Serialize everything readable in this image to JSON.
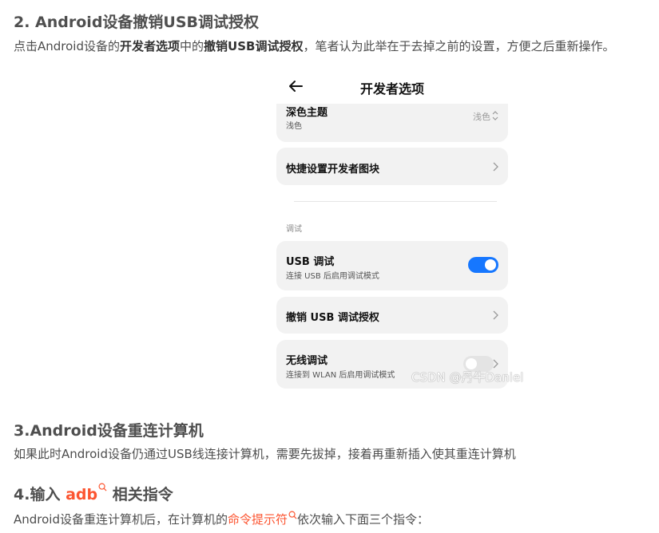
{
  "section2": {
    "heading": "2. Android设备撤销USB调试授权",
    "text_1": "点击Android设备的",
    "bold_1": "开发者选项",
    "text_2": "中的",
    "bold_2": "撤销USB调试授权",
    "text_3": "，笔者认为此举在于去掉之前的设置，方便之后重新操作。"
  },
  "phone": {
    "title": "开发者选项",
    "dark_theme": {
      "label": "深色主题",
      "sub": "浅色",
      "value": "浅色"
    },
    "quick_tiles": {
      "label": "快捷设置开发者图块"
    },
    "debug_section": "调试",
    "usb_debug": {
      "label": "USB 调试",
      "sub": "连接 USB 后启用调试模式",
      "enabled": true
    },
    "revoke": {
      "label": "撤销 USB 调试授权"
    },
    "wireless": {
      "label": "无线调试",
      "sub": "连接到 WLAN 后启用调试模式",
      "enabled": false
    }
  },
  "watermark": "CSDN @丹牛Daniel",
  "section3": {
    "heading": "3.Android设备重连计算机",
    "text": "如果此时Android设备仍通过USB线连接计算机，需要先拔掉，接着再重新插入使其重连计算机"
  },
  "section4": {
    "heading_1": "4.输入 ",
    "heading_link": "adb",
    "heading_2": " 相关指令",
    "text_1": "Android设备重连计算机后，在计算机的",
    "link": "命令提示符",
    "text_2": "依次输入下面三个指令："
  },
  "colors": {
    "link": "#fc5531",
    "toggle_on": "#1677ff"
  }
}
